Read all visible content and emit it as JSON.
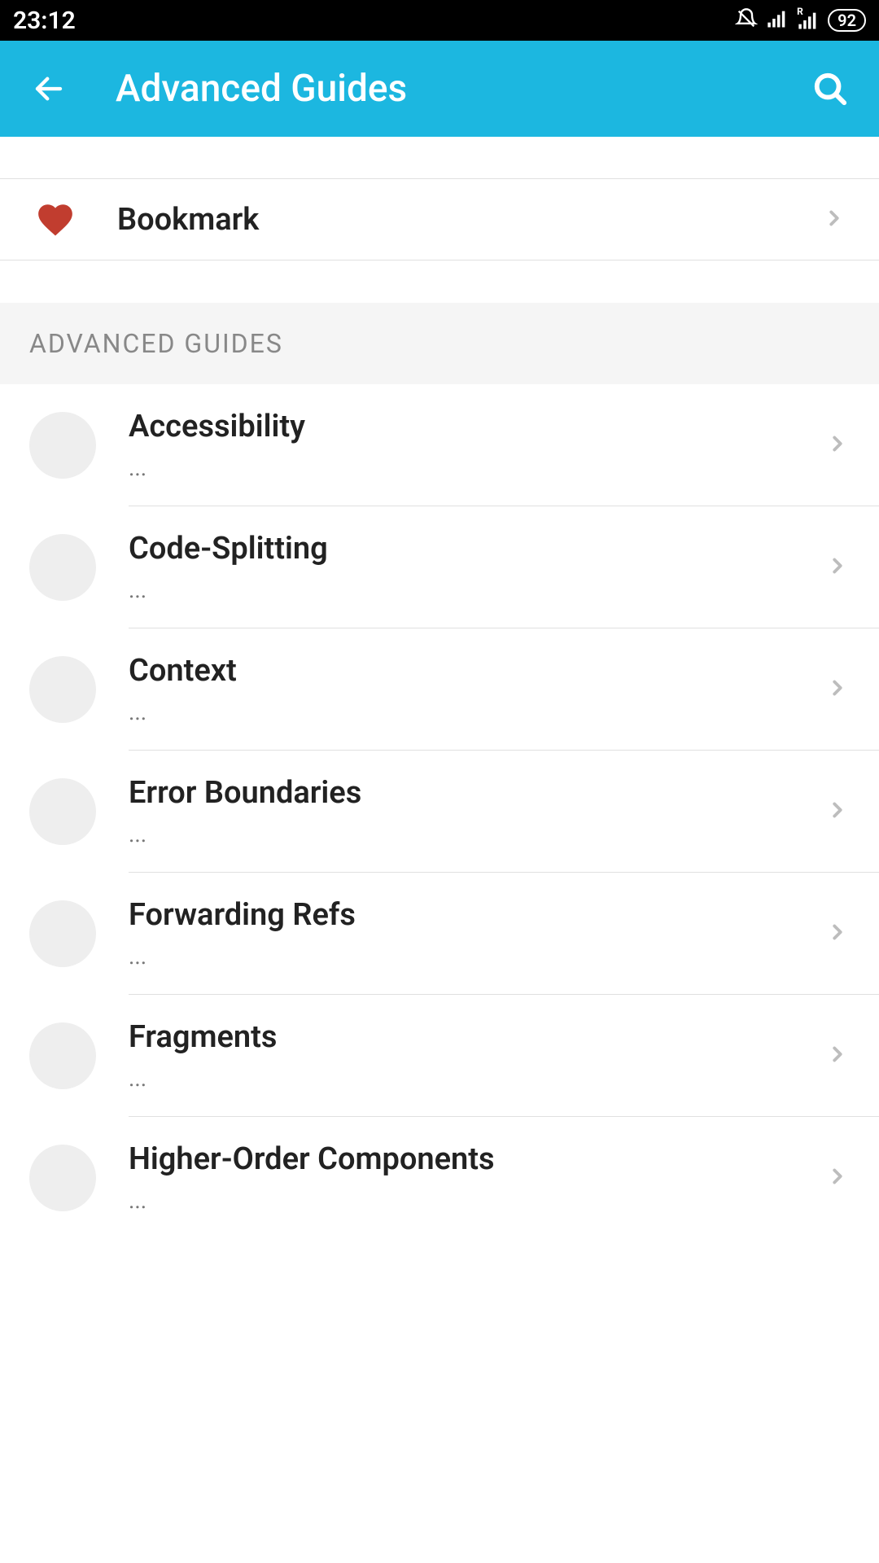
{
  "statusBar": {
    "time": "23:12",
    "battery": "92"
  },
  "appBar": {
    "title": "Advanced Guides"
  },
  "bookmark": {
    "label": "Bookmark"
  },
  "section": {
    "header": "ADVANCED GUIDES",
    "items": [
      {
        "title": "Accessibility",
        "subtitle": "..."
      },
      {
        "title": "Code-Splitting",
        "subtitle": "..."
      },
      {
        "title": "Context",
        "subtitle": "..."
      },
      {
        "title": "Error Boundaries",
        "subtitle": "..."
      },
      {
        "title": "Forwarding Refs",
        "subtitle": "..."
      },
      {
        "title": "Fragments",
        "subtitle": "..."
      },
      {
        "title": "Higher-Order Components",
        "subtitle": "..."
      }
    ]
  },
  "colors": {
    "appBarBg": "#1cb7e0",
    "heart": "#c13d2f"
  }
}
